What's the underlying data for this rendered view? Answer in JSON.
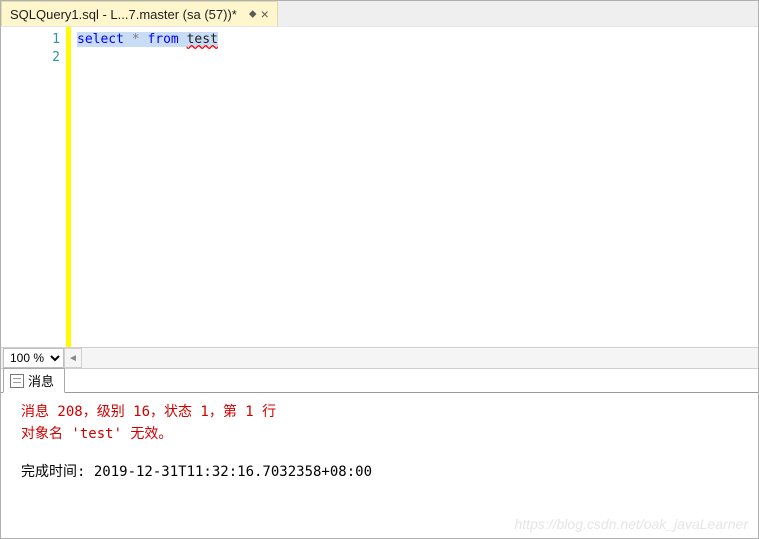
{
  "tab": {
    "title": "SQLQuery1.sql - L...7.master (sa (57))*"
  },
  "editor": {
    "lines": {
      "1": "1",
      "2": "2"
    },
    "code": {
      "select": "select",
      "star": " * ",
      "from": "from",
      "space": " ",
      "test": "test"
    }
  },
  "zoom": {
    "value": "100 %"
  },
  "resultsTab": {
    "label": "消息"
  },
  "messages": {
    "line1": "消息 208，级别 16，状态 1，第 1 行",
    "line2": "对象名 'test' 无效。",
    "done": "完成时间: 2019-12-31T11:32:16.7032358+08:00"
  },
  "watermark": "https://blog.csdn.net/oak_javaLearner"
}
